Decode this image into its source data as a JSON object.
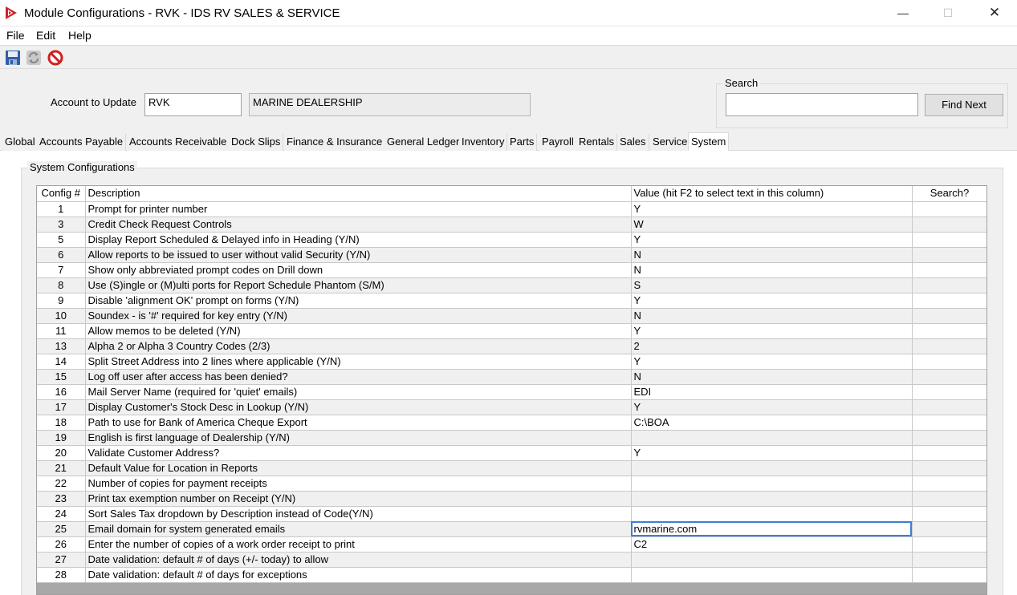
{
  "window": {
    "title": "Module Configurations - RVK - IDS RV SALES & SERVICE",
    "minimize_label": "—",
    "maximize_label": "☐",
    "close_label": "✕"
  },
  "menu": {
    "file": "File",
    "edit": "Edit",
    "help": "Help"
  },
  "toolbar": {
    "icons": [
      "save-icon",
      "refresh-icon",
      "cancel-icon"
    ]
  },
  "account": {
    "label": "Account to Update",
    "code": "RVK",
    "name": "MARINE DEALERSHIP"
  },
  "search": {
    "legend": "Search",
    "value": "",
    "find_next": "Find Next"
  },
  "tabs": [
    "Global",
    "Accounts Payable",
    "Accounts Receivable",
    "Dock Slips",
    "Finance & Insurance",
    "General Ledger",
    "Inventory",
    "Parts",
    "Payroll",
    "Rentals",
    "Sales",
    "Service",
    "System"
  ],
  "active_tab": "System",
  "group_title": "System Configurations",
  "grid": {
    "headers": {
      "num": "Config #",
      "desc": "Description",
      "value": "Value (hit F2 to select text in this column)",
      "search": "Search?"
    },
    "rows": [
      {
        "num": "1",
        "desc": "Prompt for printer number",
        "value": "Y",
        "search": ""
      },
      {
        "num": "3",
        "desc": "Credit Check Request Controls",
        "value": "W",
        "search": ""
      },
      {
        "num": "5",
        "desc": "Display Report Scheduled & Delayed info in Heading (Y/N)",
        "value": "Y",
        "search": ""
      },
      {
        "num": "6",
        "desc": "Allow reports to be issued to user without valid Security (Y/N)",
        "value": "N",
        "search": ""
      },
      {
        "num": "7",
        "desc": "Show only abbreviated prompt codes on Drill down",
        "value": "N",
        "search": ""
      },
      {
        "num": "8",
        "desc": "Use (S)ingle or (M)ulti ports for Report Schedule Phantom (S/M)",
        "value": "S",
        "search": ""
      },
      {
        "num": "9",
        "desc": "Disable 'alignment OK' prompt on forms (Y/N)",
        "value": "Y",
        "search": ""
      },
      {
        "num": "10",
        "desc": "Soundex - is '#' required for key entry (Y/N)",
        "value": "N",
        "search": ""
      },
      {
        "num": "11",
        "desc": "Allow memos to be deleted (Y/N)",
        "value": "Y",
        "search": ""
      },
      {
        "num": "13",
        "desc": "Alpha 2 or Alpha 3 Country Codes (2/3)",
        "value": "2",
        "search": ""
      },
      {
        "num": "14",
        "desc": "Split Street Address into 2 lines where applicable (Y/N)",
        "value": "Y",
        "search": ""
      },
      {
        "num": "15",
        "desc": "Log off user after access has been denied?",
        "value": "N",
        "search": ""
      },
      {
        "num": "16",
        "desc": "Mail Server Name (required for 'quiet' emails)",
        "value": "EDI",
        "search": ""
      },
      {
        "num": "17",
        "desc": "Display Customer's Stock Desc in Lookup (Y/N)",
        "value": "Y",
        "search": ""
      },
      {
        "num": "18",
        "desc": "Path to use for Bank of America Cheque Export",
        "value": "C:\\BOA",
        "search": ""
      },
      {
        "num": "19",
        "desc": "English is first language of Dealership (Y/N)",
        "value": "",
        "search": ""
      },
      {
        "num": "20",
        "desc": "Validate Customer Address?",
        "value": "Y",
        "search": ""
      },
      {
        "num": "21",
        "desc": "Default Value for Location in Reports",
        "value": "",
        "search": ""
      },
      {
        "num": "22",
        "desc": "Number of copies for payment receipts",
        "value": "",
        "search": ""
      },
      {
        "num": "23",
        "desc": "Print tax exemption number on Receipt (Y/N)",
        "value": "",
        "search": ""
      },
      {
        "num": "24",
        "desc": "Sort Sales Tax dropdown by Description instead of Code(Y/N)",
        "value": "",
        "search": ""
      },
      {
        "num": "25",
        "desc": "Email domain for system generated emails",
        "value": "rvmarine.com",
        "search": "",
        "selected": true
      },
      {
        "num": "26",
        "desc": "Enter the number of copies of a work order receipt to print",
        "value": "C2",
        "search": ""
      },
      {
        "num": "27",
        "desc": "Date validation: default # of days (+/- today) to allow",
        "value": "",
        "search": ""
      },
      {
        "num": "28",
        "desc": "Date validation: default # of days for exceptions",
        "value": "",
        "search": ""
      }
    ]
  }
}
